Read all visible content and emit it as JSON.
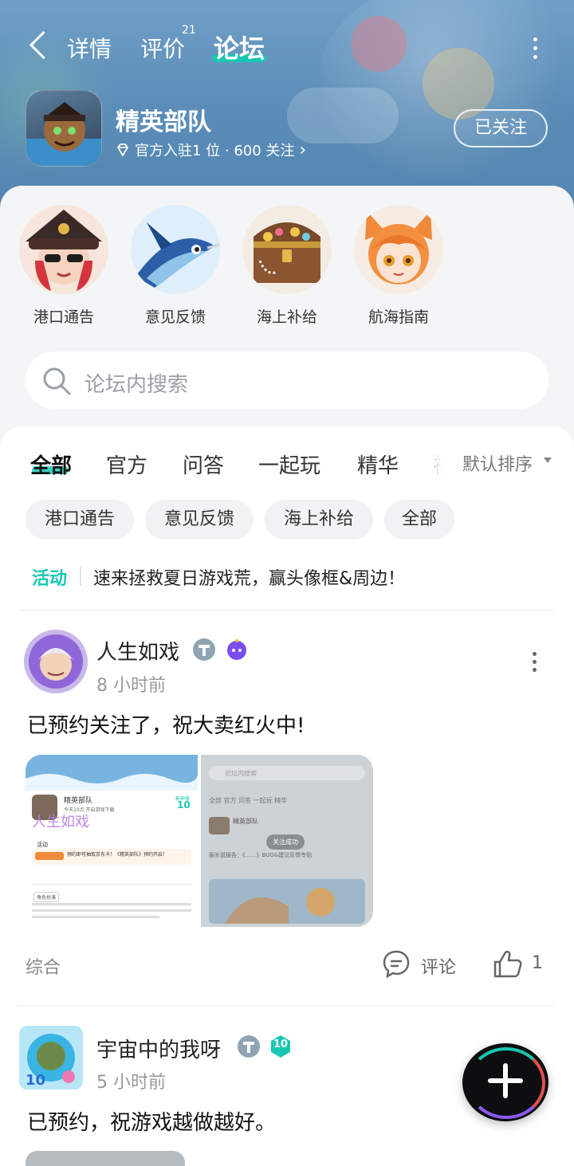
{
  "header": {
    "tabs": [
      {
        "label": "详情"
      },
      {
        "label": "评价",
        "count": "21"
      },
      {
        "label": "论坛"
      }
    ],
    "game_title": "精英部队",
    "game_meta": "官方入驻1 位 · 600 关注",
    "meta_chevron": "›",
    "follow_label": "已关注"
  },
  "quick_links": [
    {
      "label": "港口通告",
      "icon": "pirate-girl-icon"
    },
    {
      "label": "意见反馈",
      "icon": "swordfish-icon"
    },
    {
      "label": "海上补给",
      "icon": "treasure-chest-icon"
    },
    {
      "label": "航海指南",
      "icon": "fox-girl-icon"
    }
  ],
  "search": {
    "placeholder": "论坛内搜索"
  },
  "category_tabs": [
    "全部",
    "官方",
    "问答",
    "一起玩",
    "精华",
    "视"
  ],
  "sort_label": "默认排序",
  "filter_chips": [
    "港口通告",
    "意见反馈",
    "海上补给",
    "全部"
  ],
  "activity": {
    "tag": "活动",
    "text": "速来拯救夏日游戏荒，赢头像框&周边！"
  },
  "posts": [
    {
      "username": "人生如戏",
      "time": "8 小时前",
      "content": "已预约关注了，祝大卖红火中!",
      "category": "综合",
      "comment_label": "评论",
      "likes": "1",
      "thumb_left": {
        "app_name": "精英部队",
        "badge": "影神值",
        "score": "10",
        "sub": "今天10点 开启游戏下载",
        "watermark": "人生如戏",
        "activity": "活动",
        "notice": "预约即可抽取京东卡！《精英部队》预约开启！",
        "section": "角色扮演"
      },
      "thumb_right": {
        "search": "论坛内搜索",
        "tabs": "全部 官方 问答 一起玩 精华",
        "app_name": "精英部队",
        "toast": "关注成功",
        "line": "服长说报告：《……》BUG&建议反馈专贴"
      }
    },
    {
      "username": "宇宙中的我呀",
      "time": "5 小时前",
      "content": "已预约，祝游戏越做越好。",
      "level": "10"
    }
  ],
  "colors": {
    "accent": "#17c7b1",
    "header_bg": "#5b8db8"
  }
}
